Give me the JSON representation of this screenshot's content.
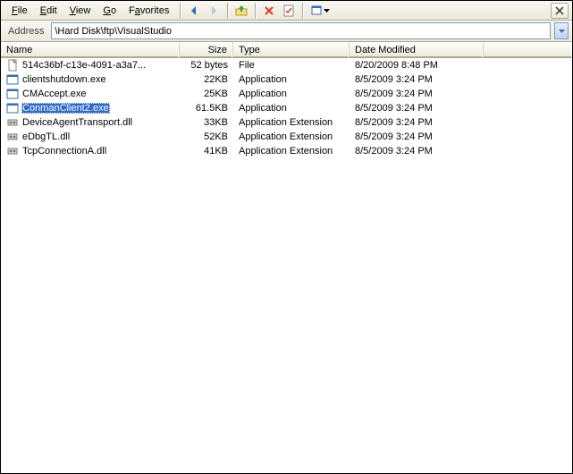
{
  "menu": {
    "file": "File",
    "edit": "Edit",
    "view": "View",
    "go": "Go",
    "favorites": "Favorites"
  },
  "address": {
    "label": "Address",
    "value": "\\Hard Disk\\ftp\\VisualStudio"
  },
  "columns": {
    "name": "Name",
    "size": "Size",
    "type": "Type",
    "date": "Date Modified"
  },
  "files": [
    {
      "name": "514c36bf-c13e-4091-a3a7...",
      "size": "52 bytes",
      "type": "File",
      "date": "8/20/2009 8:48 PM",
      "icon": "file",
      "selected": false
    },
    {
      "name": "clientshutdown.exe",
      "size": "22KB",
      "type": "Application",
      "date": "8/5/2009 3:24 PM",
      "icon": "app",
      "selected": false
    },
    {
      "name": "CMAccept.exe",
      "size": "25KB",
      "type": "Application",
      "date": "8/5/2009 3:24 PM",
      "icon": "app",
      "selected": false
    },
    {
      "name": "ConmanClient2.exe",
      "size": "61.5KB",
      "type": "Application",
      "date": "8/5/2009 3:24 PM",
      "icon": "app",
      "selected": true
    },
    {
      "name": "DeviceAgentTransport.dll",
      "size": "33KB",
      "type": "Application Extension",
      "date": "8/5/2009 3:24 PM",
      "icon": "dll",
      "selected": false
    },
    {
      "name": "eDbgTL.dll",
      "size": "52KB",
      "type": "Application Extension",
      "date": "8/5/2009 3:24 PM",
      "icon": "dll",
      "selected": false
    },
    {
      "name": "TcpConnectionA.dll",
      "size": "41KB",
      "type": "Application Extension",
      "date": "8/5/2009 3:24 PM",
      "icon": "dll",
      "selected": false
    }
  ]
}
